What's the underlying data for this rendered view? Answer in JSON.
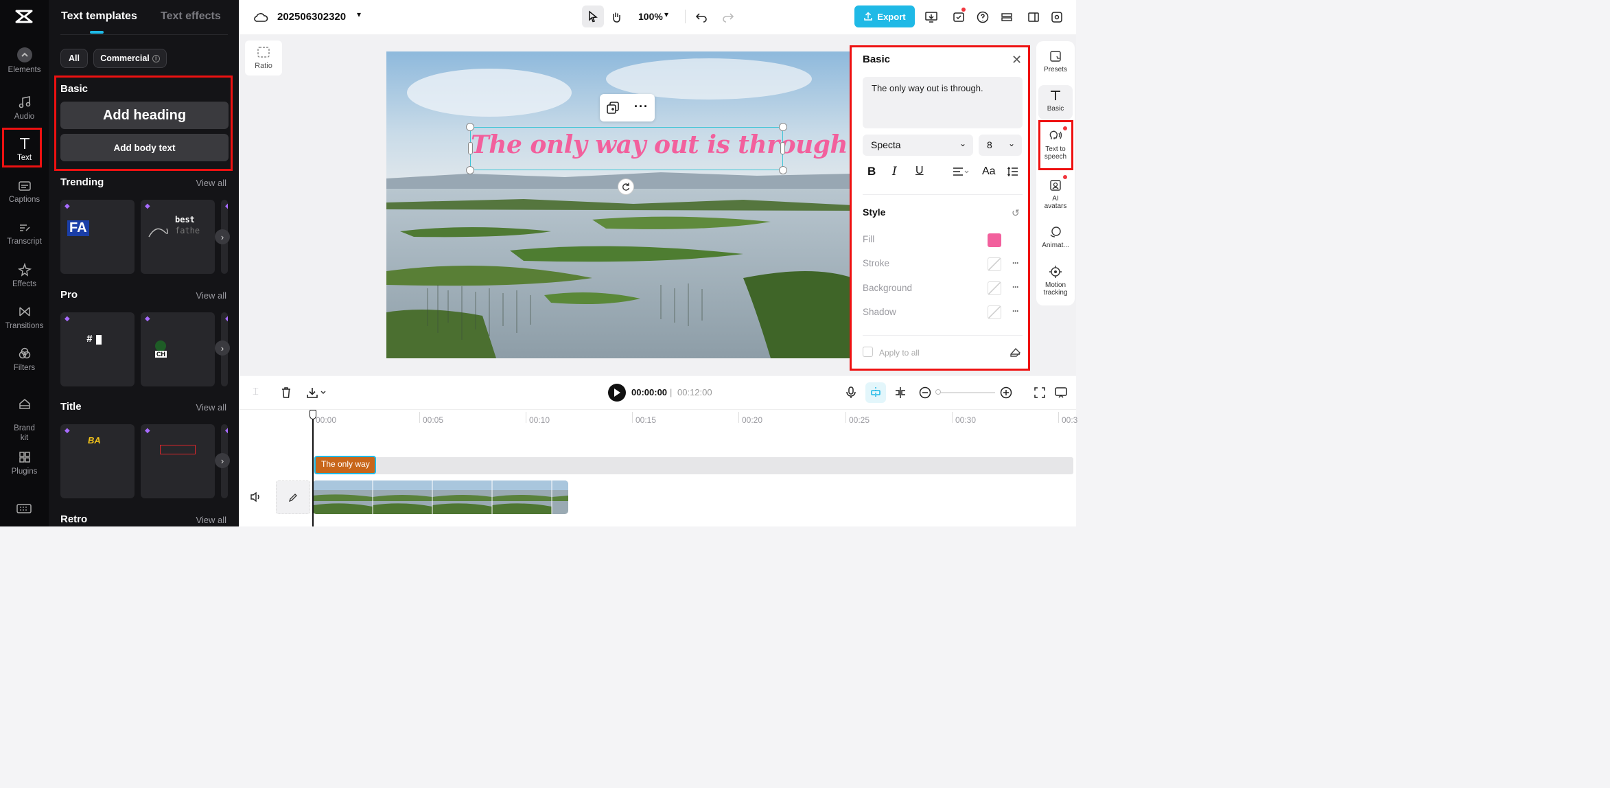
{
  "left_rail": {
    "items": [
      {
        "label": "Elements",
        "icon": "elements-icon"
      },
      {
        "label": "Audio",
        "icon": "music-note-icon"
      },
      {
        "label": "Text",
        "icon": "text-t-icon"
      },
      {
        "label": "Captions",
        "icon": "captions-icon"
      },
      {
        "label": "Transcript",
        "icon": "transcript-icon"
      },
      {
        "label": "Effects",
        "icon": "effects-star-icon"
      },
      {
        "label": "Transitions",
        "icon": "transitions-icon"
      },
      {
        "label": "Filters",
        "icon": "filters-icon"
      },
      {
        "label": "Brand\nkit",
        "icon": "brand-kit-icon"
      },
      {
        "label": "Plugins",
        "icon": "plugins-grid-icon"
      }
    ],
    "active": "Text"
  },
  "panel": {
    "tabs": [
      "Text templates",
      "Text effects"
    ],
    "filters": {
      "all": "All",
      "commercial": "Commercial"
    },
    "basic": {
      "title": "Basic",
      "add_heading": "Add heading",
      "add_body": "Add body text"
    },
    "sections": [
      {
        "title": "Trending",
        "view_all": "View all"
      },
      {
        "title": "Pro",
        "view_all": "View all"
      },
      {
        "title": "Title",
        "view_all": "View all"
      },
      {
        "title": "Retro",
        "view_all": "View all"
      }
    ],
    "card_texts": {
      "trend1": "FA",
      "trend2a": "best",
      "trend2b": "fathe",
      "pro1": "#",
      "pro2": "CH",
      "title1": "BA"
    }
  },
  "topbar": {
    "project_name": "202506302320",
    "zoom": "100%",
    "export_label": "Export"
  },
  "canvas": {
    "ratio_label": "Ratio",
    "overlay_text": "The only way out is through."
  },
  "props": {
    "title": "Basic",
    "text_value": "The only way out is through.",
    "font": "Specta",
    "font_size": "8",
    "style_title": "Style",
    "fill_label": "Fill",
    "fill_color": "#f2609d",
    "stroke_label": "Stroke",
    "background_label": "Background",
    "shadow_label": "Shadow",
    "apply_all": "Apply to all"
  },
  "right_rail": {
    "items": [
      {
        "label": "Presets"
      },
      {
        "label": "Basic"
      },
      {
        "label": "Text to speech"
      },
      {
        "label": "AI avatars"
      },
      {
        "label": "Animat..."
      },
      {
        "label": "Motion tracking"
      }
    ]
  },
  "timeline": {
    "current_time": "00:00:00",
    "separator": "|",
    "total_time": "00:12:00",
    "ticks": [
      "00:00",
      "00:05",
      "00:10",
      "00:15",
      "00:20",
      "00:25",
      "00:30",
      "00:3"
    ],
    "text_clip": "The only way"
  },
  "colors": {
    "accent": "#1fb9e6",
    "highlight": "#ee1111",
    "text_pink": "#f2609d",
    "clip": "#c8661a"
  }
}
